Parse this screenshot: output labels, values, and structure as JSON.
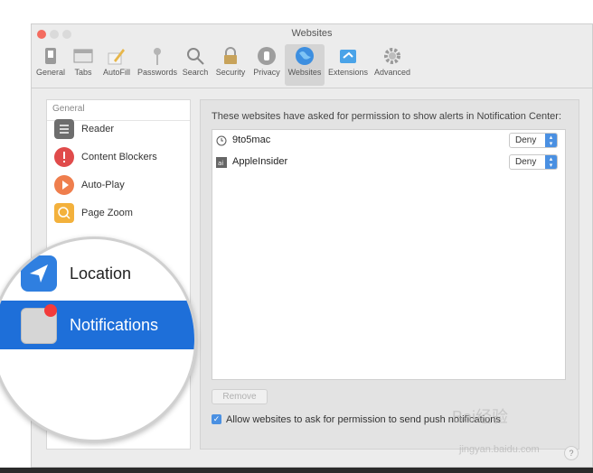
{
  "window": {
    "title": "Websites"
  },
  "toolbar": {
    "items": [
      {
        "label": "General",
        "icon": "switch-icon"
      },
      {
        "label": "Tabs",
        "icon": "tabs-icon"
      },
      {
        "label": "AutoFill",
        "icon": "pencil-icon"
      },
      {
        "label": "Passwords",
        "icon": "key-icon"
      },
      {
        "label": "Search",
        "icon": "search-icon"
      },
      {
        "label": "Security",
        "icon": "lock-icon"
      },
      {
        "label": "Privacy",
        "icon": "hand-icon"
      },
      {
        "label": "Websites",
        "icon": "globe-icon",
        "active": true
      },
      {
        "label": "Extensions",
        "icon": "puzzle-icon"
      },
      {
        "label": "Advanced",
        "icon": "gear-icon"
      }
    ]
  },
  "sidebar": {
    "header": "General",
    "items": [
      {
        "label": "Reader",
        "icon": "reader-icon",
        "color": "#6d6d6d"
      },
      {
        "label": "Content Blockers",
        "icon": "content-blockers-icon",
        "color": "#e04b4b"
      },
      {
        "label": "Auto-Play",
        "icon": "play-icon",
        "color": "#ef7e4d"
      },
      {
        "label": "Page Zoom",
        "icon": "zoom-icon",
        "color": "#f3b13c"
      }
    ]
  },
  "magnifier": {
    "location_label": "Location",
    "notifications_label": "Notifications",
    "selection_color": "#1e6fd9"
  },
  "main": {
    "description": "These websites have asked for permission to show alerts in Notification Center:",
    "sites": [
      {
        "name": "9to5mac",
        "icon": "clock-icon",
        "permission": "Deny"
      },
      {
        "name": "AppleInsider",
        "icon": "appleinsider-icon",
        "permission": "Deny"
      }
    ],
    "remove_label": "Remove",
    "allow_label": "Allow websites to ask for permission to send push notifications",
    "allow_checked": true
  },
  "watermark": {
    "text": "Bai经验",
    "url": "jingyan.baidu.com"
  }
}
